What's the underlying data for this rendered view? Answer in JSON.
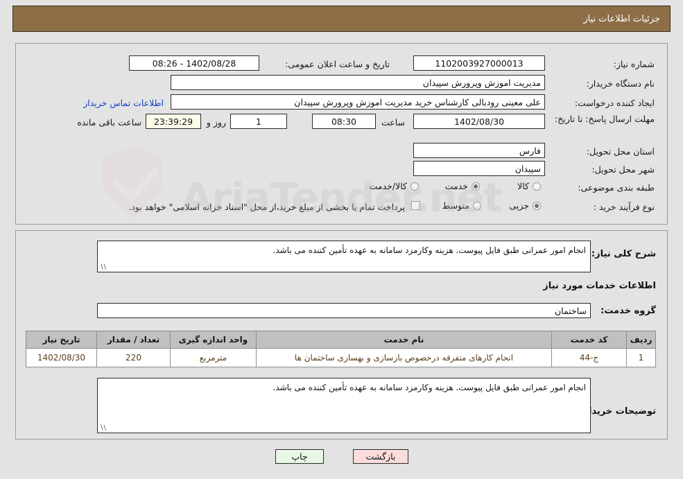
{
  "header": {
    "title": "جزئیات اطلاعات نیاز"
  },
  "form": {
    "need_number_label": "شماره نیاز:",
    "need_number_value": "1102003927000013",
    "announce_datetime_label": "تاریخ و ساعت اعلان عمومی:",
    "announce_datetime_value": "1402/08/28 - 08:26",
    "buyer_org_label": "نام دستگاه خریدار:",
    "buyer_org_value": "مدیریت اموزش وپرورش سپیدان",
    "buyer_org_value2": "",
    "requester_label": "ایجاد کننده درخواست:",
    "requester_value": "علی معینی رودبالی کارشناس خرید مدیریت اموزش وپرورش سپیدان",
    "buyer_contact_link": "اطلاعات تماس خریدار",
    "deadline_label": "مهلت ارسال پاسخ: تا تاریخ:",
    "deadline_date": "1402/08/30",
    "hour_label": "ساعت",
    "deadline_time": "08:30",
    "days_value": "1",
    "days_label": "روز و",
    "countdown_value": "23:39:29",
    "remaining_label": "ساعت باقی مانده",
    "province_label": "استان محل تحویل:",
    "province_value": "فارس",
    "city_label": "شهر محل تحویل:",
    "city_value": "سپیدان",
    "category_label": "طبقه بندی موضوعی:",
    "category_options": [
      {
        "label": "کالا",
        "selected": false
      },
      {
        "label": "خدمت",
        "selected": true
      },
      {
        "label": "کالا/خدمت",
        "selected": false
      }
    ],
    "process_label": "نوع فرآیند خرید :",
    "process_options": [
      {
        "label": "جزیی",
        "selected": true
      },
      {
        "label": "متوسط",
        "selected": false
      }
    ],
    "treasury_note": "پرداخت تمام یا بخشی از مبلغ خرید،از محل \"اسناد خزانه اسلامی\" خواهد بود."
  },
  "details": {
    "general_desc_label": "شرح کلی نیاز:",
    "general_desc_value": "انجام امور عمرانی طبق فایل پیوست. هزینه وکارمزد سامانه به عهده تأمین کننده می باشد.",
    "services_section_title": "اطلاعات خدمات مورد نیاز",
    "service_group_label": "گروه خدمت:",
    "service_group_value": "ساختمان",
    "buyer_notes_label": "توضیحات خریدار:",
    "buyer_notes_value": "انجام امور عمرانی طبق فایل پیوست. هزینه وکارمزد سامانه به عهده تأمین کننده می باشد."
  },
  "table": {
    "columns": [
      "ردیف",
      "کد خدمت",
      "نام خدمت",
      "واحد اندازه گیری",
      "تعداد / مقدار",
      "تاریخ نیاز"
    ],
    "rows": [
      {
        "row": "1",
        "code": "ج-44",
        "name": "انجام کارهای متفرقه درخصوص بازسازی و بهسازی ساختمان ها",
        "unit": "مترمربع",
        "qty": "220",
        "date": "1402/08/30"
      }
    ]
  },
  "footer": {
    "print_label": "چاپ",
    "back_label": "بازگشت"
  },
  "watermark": {
    "text": "AriaTender.net"
  }
}
